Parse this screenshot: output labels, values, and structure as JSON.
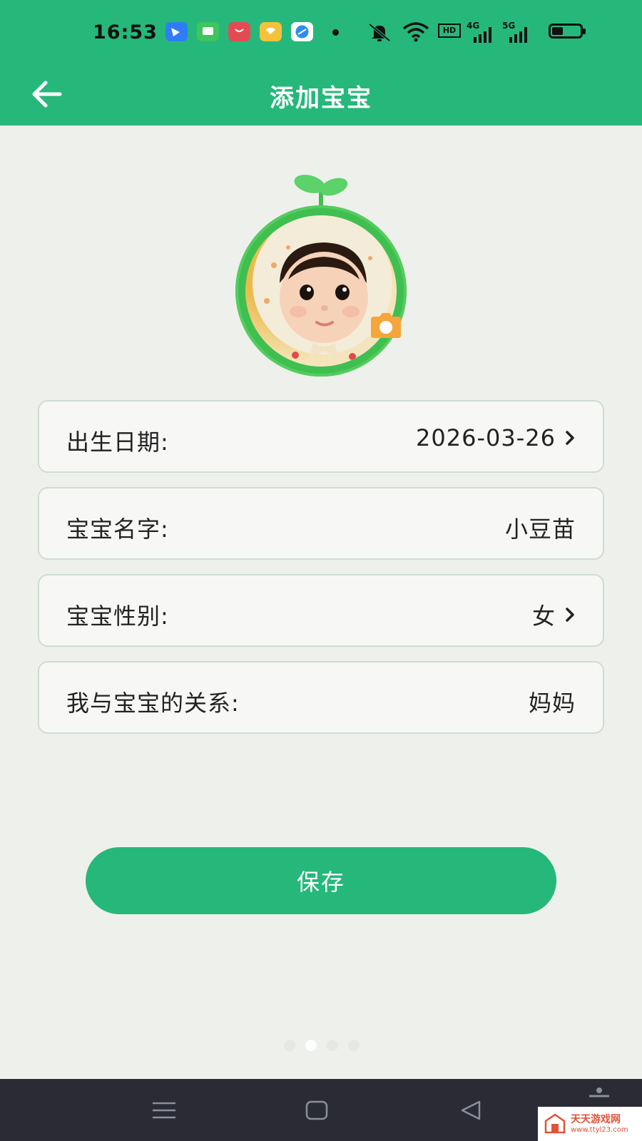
{
  "status_bar": {
    "time": "16:53",
    "notification_icons": [
      {
        "name": "feishu-icon",
        "color": "#2f7df6"
      },
      {
        "name": "messages-icon",
        "color": "#3fc45e"
      },
      {
        "name": "app-gallery-icon",
        "color": "#e34b52"
      },
      {
        "name": "diamond-app-icon",
        "color": "#f2c23a"
      },
      {
        "name": "browser-icon",
        "color": "#2d8cf0"
      }
    ],
    "hd_label": "HD",
    "network_1": "4G",
    "network_2": "5G"
  },
  "header": {
    "title": "添加宝宝",
    "background": "#25b87a"
  },
  "form": {
    "rows": [
      {
        "label": "出生日期:",
        "value": "2026-03-26"
      },
      {
        "label": "宝宝名字:",
        "value": "小豆苗"
      },
      {
        "label": "宝宝性别:",
        "value": "女"
      },
      {
        "label": "我与宝宝的关系:",
        "value": "妈妈"
      }
    ]
  },
  "save_button": {
    "label": "保存",
    "color": "#25b87a"
  },
  "pager": {
    "count": 4,
    "active_index": 1
  },
  "watermark": {
    "title": "天天游戏网",
    "url": "www.ttyl23.com"
  }
}
